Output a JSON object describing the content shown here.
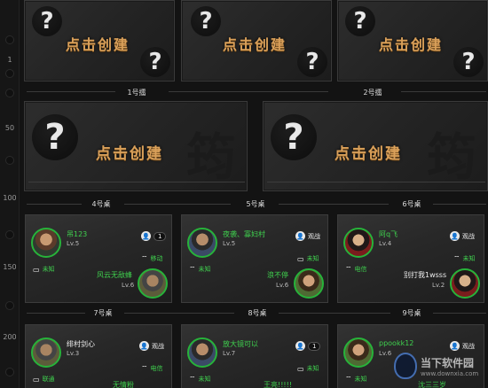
{
  "ruler": {
    "labels": [
      "1",
      "50",
      "100",
      "150",
      "200"
    ]
  },
  "create_label": "点击创建",
  "empty_tables": {
    "row1_names": [
      "1号擂",
      "2号擂"
    ],
    "row2_names": [
      "4号桌",
      "5号桌",
      "6号桌"
    ]
  },
  "tables": [
    {
      "p1": {
        "name": "吊123",
        "level": "Lv.5",
        "net": "未知"
      },
      "spectate": "1",
      "p2": {
        "name": "风云无敌蜂",
        "level": "Lv.6",
        "net": "移动"
      }
    },
    {
      "p1": {
        "name": "夜袭、寡妇村",
        "level": "Lv.5",
        "net": "未知"
      },
      "spectate": "观战",
      "p2": {
        "name": "浪不停",
        "level": "Lv.6",
        "net": "未知"
      }
    },
    {
      "p1": {
        "name": "阿q飞",
        "level": "Lv.4",
        "net": "电信"
      },
      "spectate": "观战",
      "p2": {
        "name": "别打我1wsss",
        "level": "Lv.2",
        "net": "未知"
      }
    }
  ],
  "row3_names": [
    "7号桌",
    "8号桌",
    "9号桌"
  ],
  "tables_row4": [
    {
      "p1": {
        "name": "绯村剑心",
        "level": "Lv.3",
        "net": "联通"
      },
      "spectate": "观战",
      "p2": {
        "name": "无情粉",
        "net": "电信"
      }
    },
    {
      "p1": {
        "name": "放大镜可以",
        "level": "Lv.7",
        "net": "未知"
      },
      "spectate": "1",
      "p2": {
        "name": "王亮!!!!!",
        "net": "未知"
      }
    },
    {
      "p1": {
        "name": "ppookk12",
        "level": "Lv.6",
        "net": "未知"
      },
      "spectate": "观战",
      "p2": {
        "name": "沈三三岁"
      }
    }
  ],
  "watermark": {
    "title": "当下软件园",
    "sub": "www.downxia.com"
  }
}
